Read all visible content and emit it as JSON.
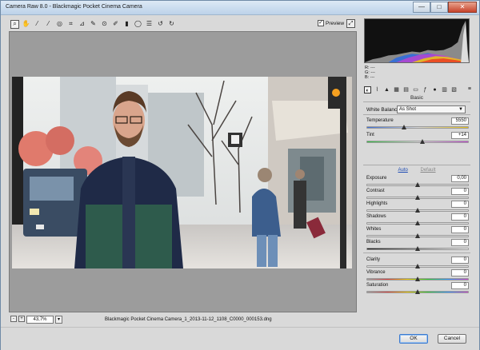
{
  "window": {
    "title": "Camera Raw 8.0  -  Blackmagic Pocket Cinema Camera",
    "minimize": "—",
    "maximize": "□",
    "close": "✕"
  },
  "toolbar": {
    "tools": [
      "zoom-tool-icon",
      "hand-tool-icon",
      "white-balance-tool-icon",
      "color-sampler-tool-icon",
      "targeted-adjustment-tool-icon",
      "crop-tool-icon",
      "straighten-tool-icon",
      "spot-removal-tool-icon",
      "red-eye-removal-tool-icon",
      "adjustment-brush-icon",
      "graduated-filter-icon",
      "radial-filter-icon",
      "preferences-icon",
      "rotate-ccw-icon",
      "rotate-cw-icon"
    ],
    "preview_label": "Preview",
    "preview_checked": "✓"
  },
  "histogram": {
    "r_label": "R:",
    "g_label": "G:",
    "b_label": "B:",
    "r_value": "---",
    "g_value": "---",
    "b_value": "---"
  },
  "panel": {
    "title": "Basic",
    "menu": "≡",
    "white_balance_label": "White Balance:",
    "white_balance_value": "As Shot",
    "auto": "Auto",
    "default": "Default",
    "sliders": [
      {
        "label": "Temperature",
        "value": "5550",
        "level": 0.37,
        "track": "temp"
      },
      {
        "label": "Tint",
        "value": "+14",
        "level": 0.55,
        "track": "tint"
      },
      {
        "label": "Exposure",
        "value": "0,00",
        "level": 0.5,
        "track": "gray"
      },
      {
        "label": "Contrast",
        "value": "0",
        "level": 0.5,
        "track": "gray"
      },
      {
        "label": "Highlights",
        "value": "0",
        "level": 0.5,
        "track": "gray"
      },
      {
        "label": "Shadows",
        "value": "0",
        "level": 0.5,
        "track": "gray"
      },
      {
        "label": "Whites",
        "value": "0",
        "level": 0.5,
        "track": "gray"
      },
      {
        "label": "Blacks",
        "value": "0",
        "level": 0.5,
        "track": "dark"
      },
      {
        "label": "Clarity",
        "value": "0",
        "level": 0.5,
        "track": "gray"
      },
      {
        "label": "Vibrance",
        "value": "0",
        "level": 0.5,
        "track": "vib"
      },
      {
        "label": "Saturation",
        "value": "0",
        "level": 0.5,
        "track": "vib"
      }
    ]
  },
  "statusbar": {
    "zoom_out": "-",
    "zoom_in": "+",
    "zoom_level": "43,7%",
    "zoom_dropdown": "▾",
    "filename": "Blackmagic Pocket Cinema Camera_1_2013-11-12_1108_C0000_000153.dng"
  },
  "buttons": {
    "ok": "OK",
    "cancel": "Cancel"
  },
  "colors": {
    "accent": "#3b7ad0",
    "canvas": "#9c9c9c",
    "panel": "#d9d9d9"
  }
}
